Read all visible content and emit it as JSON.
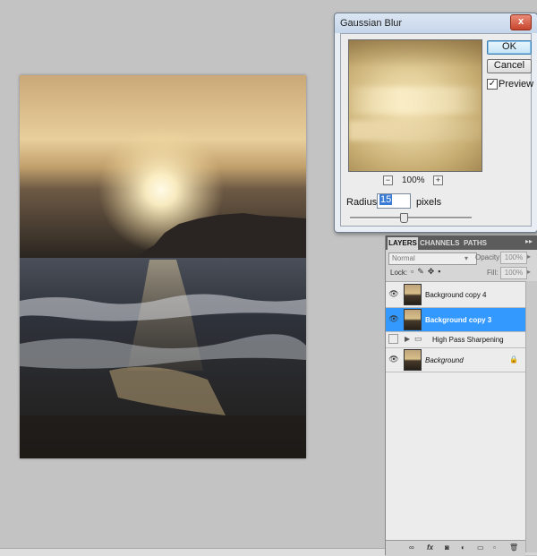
{
  "dialog": {
    "title": "Gaussian Blur",
    "close_glyph": "x",
    "ok_label": "OK",
    "cancel_label": "Cancel",
    "preview_label": "Preview",
    "preview_checked": true,
    "zoom": "100%",
    "zoom_minus": "−",
    "zoom_plus": "+",
    "radius_label": "Radius:",
    "radius_value": "15",
    "radius_unit": "pixels",
    "slider_fraction": 0.42
  },
  "layers_panel": {
    "tabs": [
      "LAYERS",
      "CHANNELS",
      "PATHS"
    ],
    "active_tab": "LAYERS",
    "menu_glyph": "▸▸",
    "blend_mode": "Normal",
    "opacity_label": "Opacity:",
    "opacity_value": "100%",
    "lock_label": "Lock:",
    "fill_label": "Fill:",
    "fill_value": "100%",
    "layers": [
      {
        "name": "Background copy 4",
        "visible": true,
        "selected": false,
        "type": "layer"
      },
      {
        "name": "Background copy 3",
        "visible": true,
        "selected": true,
        "type": "layer"
      },
      {
        "name": "High Pass Sharpening",
        "visible": false,
        "selected": false,
        "type": "group"
      },
      {
        "name": "Background",
        "visible": true,
        "selected": false,
        "type": "layer",
        "locked": true
      }
    ],
    "footer_icons": [
      "link-icon",
      "fx-icon",
      "mask-icon",
      "adjustment-icon",
      "folder-icon",
      "new-layer-icon",
      "trash-icon"
    ]
  },
  "colors": {
    "selection": "#3399ff",
    "workspace": "#c3c3c3"
  }
}
